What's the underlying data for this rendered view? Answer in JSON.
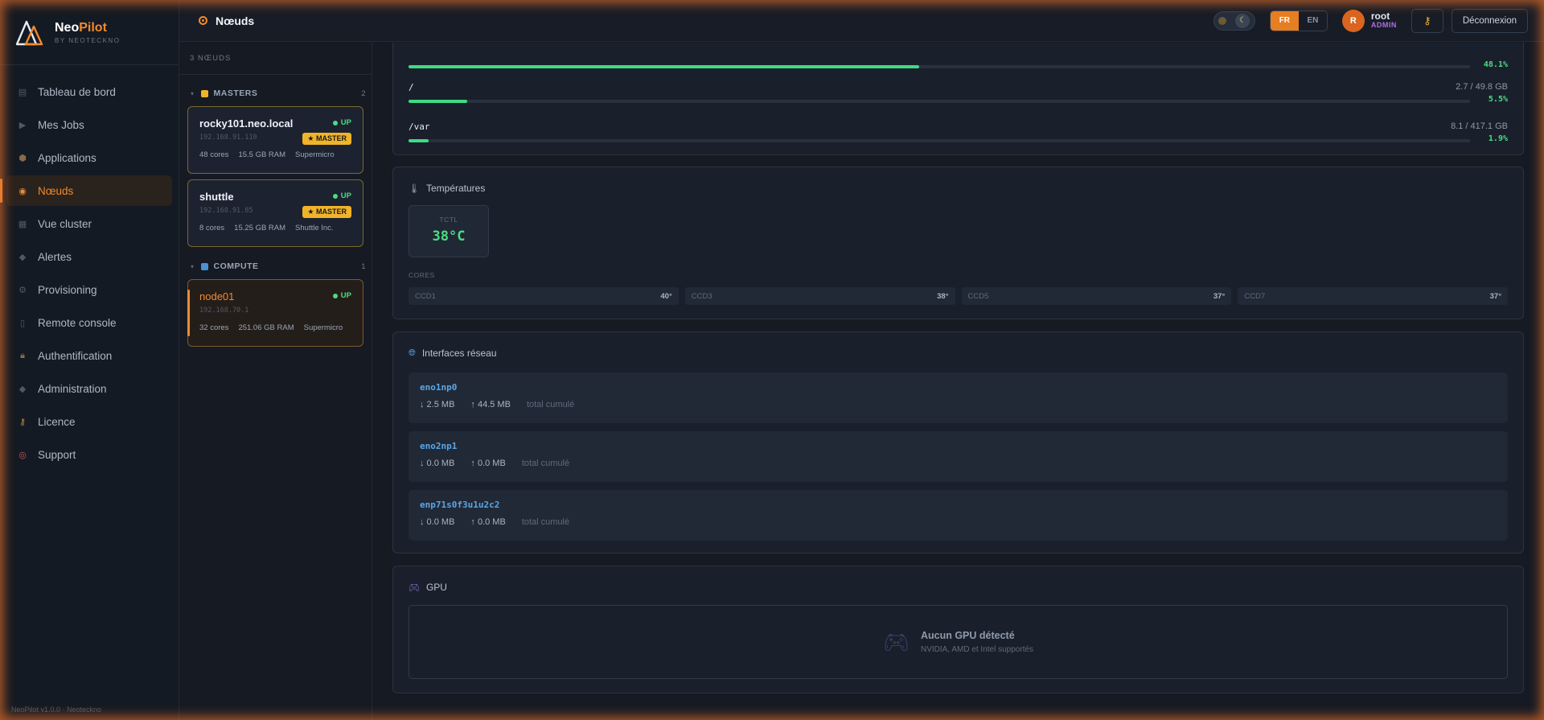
{
  "brand": {
    "name_part1": "Neo",
    "name_part2": "Pilot",
    "subtitle": "BY NEOTECKNO"
  },
  "nav": [
    {
      "label": "Tableau de bord",
      "icon": "dashboard-icon",
      "active": false
    },
    {
      "label": "Mes Jobs",
      "icon": "play-icon",
      "active": false
    },
    {
      "label": "Applications",
      "icon": "cube-icon",
      "active": false
    },
    {
      "label": "Nœuds",
      "icon": "node-icon",
      "active": true
    },
    {
      "label": "Vue cluster",
      "icon": "grid-icon",
      "active": false
    },
    {
      "label": "Alertes",
      "icon": "alert-icon",
      "active": false
    },
    {
      "label": "Provisioning",
      "icon": "gear-icon",
      "active": false
    },
    {
      "label": "Remote console",
      "icon": "console-icon",
      "active": false
    },
    {
      "label": "Authentification",
      "icon": "lock-icon",
      "active": false
    },
    {
      "label": "Administration",
      "icon": "diamond-icon",
      "active": false
    },
    {
      "label": "Licence",
      "icon": "key-icon",
      "active": false
    },
    {
      "label": "Support",
      "icon": "lifebuoy-icon",
      "active": false
    }
  ],
  "footer": "NeoPilot v1.0.0 · Neoteckno",
  "topbar": {
    "title": "Nœuds",
    "lang_fr": "FR",
    "lang_en": "EN",
    "user_initial": "R",
    "user_name": "root",
    "user_role": "ADMIN",
    "logout": "Déconnexion"
  },
  "nodes_panel": {
    "count": "3 NŒUDS",
    "groups": [
      {
        "name": "MASTERS",
        "count": "2",
        "color": "#f0b429",
        "nodes": [
          {
            "name": "rocky101.neo.local",
            "ip": "192.168.91.110",
            "status": "UP",
            "badge": "★ MASTER",
            "cores": "48 cores",
            "ram": "15.5 GB RAM",
            "vendor": "Supermicro"
          },
          {
            "name": "shuttle",
            "ip": "192.168.91.85",
            "status": "UP",
            "badge": "★ MASTER",
            "cores": "8 cores",
            "ram": "15.25 GB RAM",
            "vendor": "Shuttle Inc."
          }
        ]
      },
      {
        "name": "COMPUTE",
        "count": "1",
        "color": "#4a90d9",
        "nodes": [
          {
            "name": "node01",
            "ip": "192.168.70.1",
            "status": "UP",
            "cores": "32 cores",
            "ram": "251.06 GB RAM",
            "vendor": "Supermicro"
          }
        ]
      }
    ]
  },
  "disks": [
    {
      "mount": "",
      "size": "",
      "pct_label": "48.1%",
      "pct": 48.1
    },
    {
      "mount": "/",
      "size": "2.7 / 49.8 GB",
      "pct_label": "5.5%",
      "pct": 5.5
    },
    {
      "mount": "/var",
      "size": "8.1 / 417.1 GB",
      "pct_label": "1.9%",
      "pct": 1.9
    }
  ],
  "temperatures": {
    "title": "Températures",
    "tctl_label": "TCTL",
    "tctl_value": "38°C",
    "cores_label": "CORES",
    "cores": [
      {
        "name": "CCD1",
        "value": "40°"
      },
      {
        "name": "CCD3",
        "value": "38°"
      },
      {
        "name": "CCD5",
        "value": "37°"
      },
      {
        "name": "CCD7",
        "value": "37°"
      }
    ]
  },
  "network": {
    "title": "Interfaces réseau",
    "interfaces": [
      {
        "name": "eno1np0",
        "down": "↓ 2.5 MB",
        "up": "↑ 44.5 MB",
        "note": "total cumulé"
      },
      {
        "name": "eno2np1",
        "down": "↓ 0.0 MB",
        "up": "↑ 0.0 MB",
        "note": "total cumulé"
      },
      {
        "name": "enp71s0f3u1u2c2",
        "down": "↓ 0.0 MB",
        "up": "↑ 0.0 MB",
        "note": "total cumulé"
      }
    ]
  },
  "gpu": {
    "title": "GPU",
    "empty_title": "Aucun GPU détecté",
    "empty_sub": "NVIDIA, AMD et Intel supportés"
  },
  "colors": {
    "accent": "#f28a2e",
    "ok": "#4ade80",
    "master": "#f0b429",
    "compute": "#4a90d9",
    "link": "#5aa6e8"
  }
}
